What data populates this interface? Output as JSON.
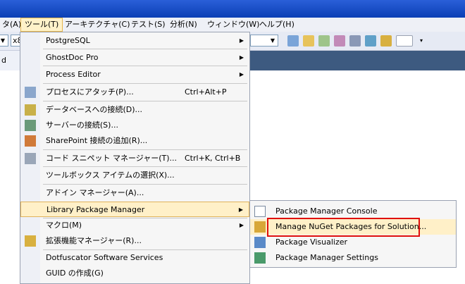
{
  "menubar": {
    "items": [
      "タ(A)",
      "ツール(T)",
      "アーキテクチャ(C)",
      "テスト(S)",
      "分析(N)",
      "ウィンドウ(W)",
      "ヘルプ(H)"
    ]
  },
  "toolbar": {
    "left_combo": "",
    "mid_combo": "x8"
  },
  "left_strip_text": "d",
  "tools_menu": {
    "items": [
      {
        "label": "PostgreSQL",
        "shortcut": "",
        "submenu": "▶"
      },
      {
        "label": "GhostDoc Pro",
        "shortcut": "",
        "submenu": "▶"
      },
      {
        "label": "Process Editor",
        "shortcut": "",
        "submenu": "▶"
      },
      {
        "label": "プロセスにアタッチ(P)...",
        "shortcut": "Ctrl+Alt+P",
        "submenu": ""
      },
      {
        "label": "データベースへの接続(D)...",
        "shortcut": "",
        "submenu": ""
      },
      {
        "label": "サーバーの接続(S)...",
        "shortcut": "",
        "submenu": ""
      },
      {
        "label": "SharePoint 接続の追加(R)...",
        "shortcut": "",
        "submenu": ""
      },
      {
        "label": "コード スニペット マネージャー(T)...",
        "shortcut": "Ctrl+K, Ctrl+B",
        "submenu": ""
      },
      {
        "label": "ツールボックス アイテムの選択(X)...",
        "shortcut": "",
        "submenu": ""
      },
      {
        "label": "アドイン マネージャー(A)...",
        "shortcut": "",
        "submenu": ""
      },
      {
        "label": "Library Package Manager",
        "shortcut": "",
        "submenu": "▶"
      },
      {
        "label": "マクロ(M)",
        "shortcut": "",
        "submenu": "▶"
      },
      {
        "label": "拡張機能マネージャー(R)...",
        "shortcut": "",
        "submenu": ""
      },
      {
        "label": "Dotfuscator Software Services",
        "shortcut": "",
        "submenu": ""
      },
      {
        "label": "GUID の作成(G)",
        "shortcut": "",
        "submenu": ""
      }
    ]
  },
  "library_submenu": {
    "items": [
      {
        "label": "Package Manager Console"
      },
      {
        "label": "Manage NuGet Packages for Solution..."
      },
      {
        "label": "Package Visualizer"
      },
      {
        "label": "Package Manager Settings"
      }
    ]
  },
  "colors": {
    "title_blue": "#0b3fb5",
    "highlight": "#fff0c8",
    "annotation_red": "#e0100c"
  }
}
